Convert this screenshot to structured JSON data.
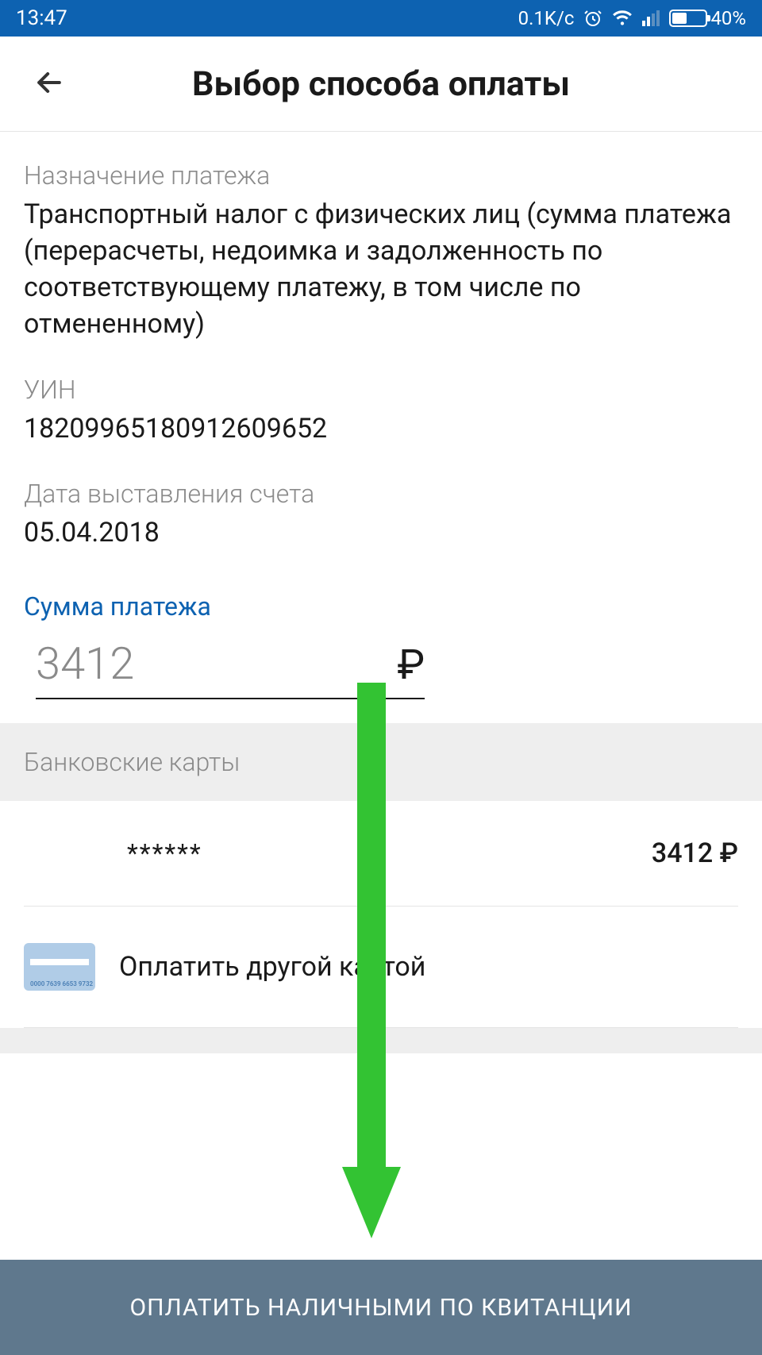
{
  "status_bar": {
    "time": "13:47",
    "speed": "0.1K/c",
    "battery": "40%"
  },
  "header": {
    "title": "Выбор способа оплаты"
  },
  "fields": {
    "purpose_label": "Назначение платежа",
    "purpose_value": "Транспортный налог с физических лиц (сумма платежа (перерасчеты, недоимка и задолженность по соответствующему платежу, в том числе по отмененному)",
    "uin_label": "УИН",
    "uin_value": "18209965180912609652",
    "date_label": "Дата выставления счета",
    "date_value": "05.04.2018",
    "amount_label": "Сумма платежа",
    "amount_value": "3412",
    "currency": "₽"
  },
  "cards": {
    "section_label": "Банковские карты",
    "saved_card_mask": "******",
    "saved_card_amount": "3412 ₽",
    "other_card_label": "Оплатить другой картой",
    "card_icon_digits": "0000 7639 6653 9732"
  },
  "footer": {
    "cash_button": "ОПЛАТИТЬ НАЛИЧНЫМИ ПО КВИТАНЦИИ"
  }
}
